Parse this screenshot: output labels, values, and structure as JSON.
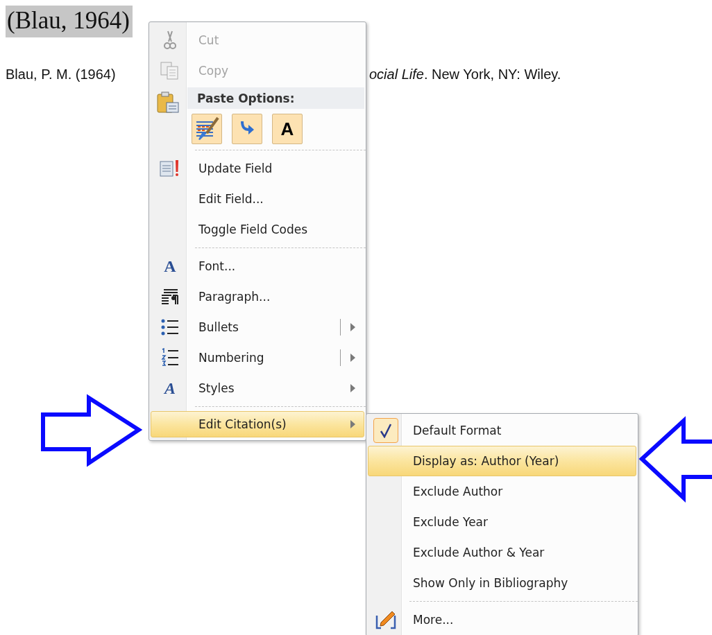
{
  "document": {
    "citation": "(Blau, 1964)",
    "reference_left": "Blau, P. M. (1964)",
    "reference_right": "*ocial Life*. New York, NY: Wiley."
  },
  "menu": {
    "items": [
      {
        "kind": "item",
        "label": "Cut",
        "disabled": true,
        "selected": false,
        "submenu": false,
        "split": false
      },
      {
        "kind": "item",
        "label": "Copy",
        "disabled": true,
        "selected": false,
        "submenu": false,
        "split": false
      },
      {
        "kind": "header",
        "label": "Paste Options:"
      },
      {
        "kind": "paste_buttons",
        "buttons": [
          {
            "kind": "keep_source"
          },
          {
            "kind": "merge"
          },
          {
            "kind": "text_only",
            "glyph": "A"
          }
        ]
      },
      {
        "kind": "separator"
      },
      {
        "kind": "item",
        "label": "Update Field",
        "disabled": false,
        "selected": false,
        "submenu": false,
        "split": false
      },
      {
        "kind": "item",
        "label": "Edit Field...",
        "disabled": false,
        "selected": false,
        "submenu": false,
        "split": false
      },
      {
        "kind": "item",
        "label": "Toggle Field Codes",
        "disabled": false,
        "selected": false,
        "submenu": false,
        "split": false
      },
      {
        "kind": "separator"
      },
      {
        "kind": "item",
        "label": "Font...",
        "glyph": "A",
        "disabled": false,
        "selected": false,
        "submenu": false,
        "split": false
      },
      {
        "kind": "item",
        "label": "Paragraph...",
        "disabled": false,
        "selected": false,
        "submenu": false,
        "split": false
      },
      {
        "kind": "item",
        "label": "Bullets",
        "disabled": false,
        "selected": false,
        "submenu": true,
        "split": true
      },
      {
        "kind": "item",
        "label": "Numbering",
        "disabled": false,
        "selected": false,
        "submenu": true,
        "split": true
      },
      {
        "kind": "item",
        "label": "Styles",
        "glyph": "A",
        "disabled": false,
        "selected": false,
        "submenu": true,
        "split": false
      },
      {
        "kind": "separator"
      },
      {
        "kind": "item",
        "label": "Edit Citation(s)",
        "disabled": false,
        "selected": true,
        "submenu": true,
        "split": false
      }
    ]
  },
  "submenu": {
    "items": [
      {
        "kind": "item",
        "label": "Default Format",
        "checked": true,
        "selected": false
      },
      {
        "kind": "item",
        "label": "Display as: Author (Year)",
        "checked": false,
        "selected": true
      },
      {
        "kind": "item",
        "label": "Exclude Author",
        "checked": false,
        "selected": false
      },
      {
        "kind": "item",
        "label": "Exclude Year",
        "checked": false,
        "selected": false
      },
      {
        "kind": "item",
        "label": "Exclude Author & Year",
        "checked": false,
        "selected": false
      },
      {
        "kind": "item",
        "label": "Show Only in Bibliography",
        "checked": false,
        "selected": false
      },
      {
        "kind": "separator"
      },
      {
        "kind": "item",
        "label": "More...",
        "checked": false,
        "selected": false
      }
    ]
  }
}
